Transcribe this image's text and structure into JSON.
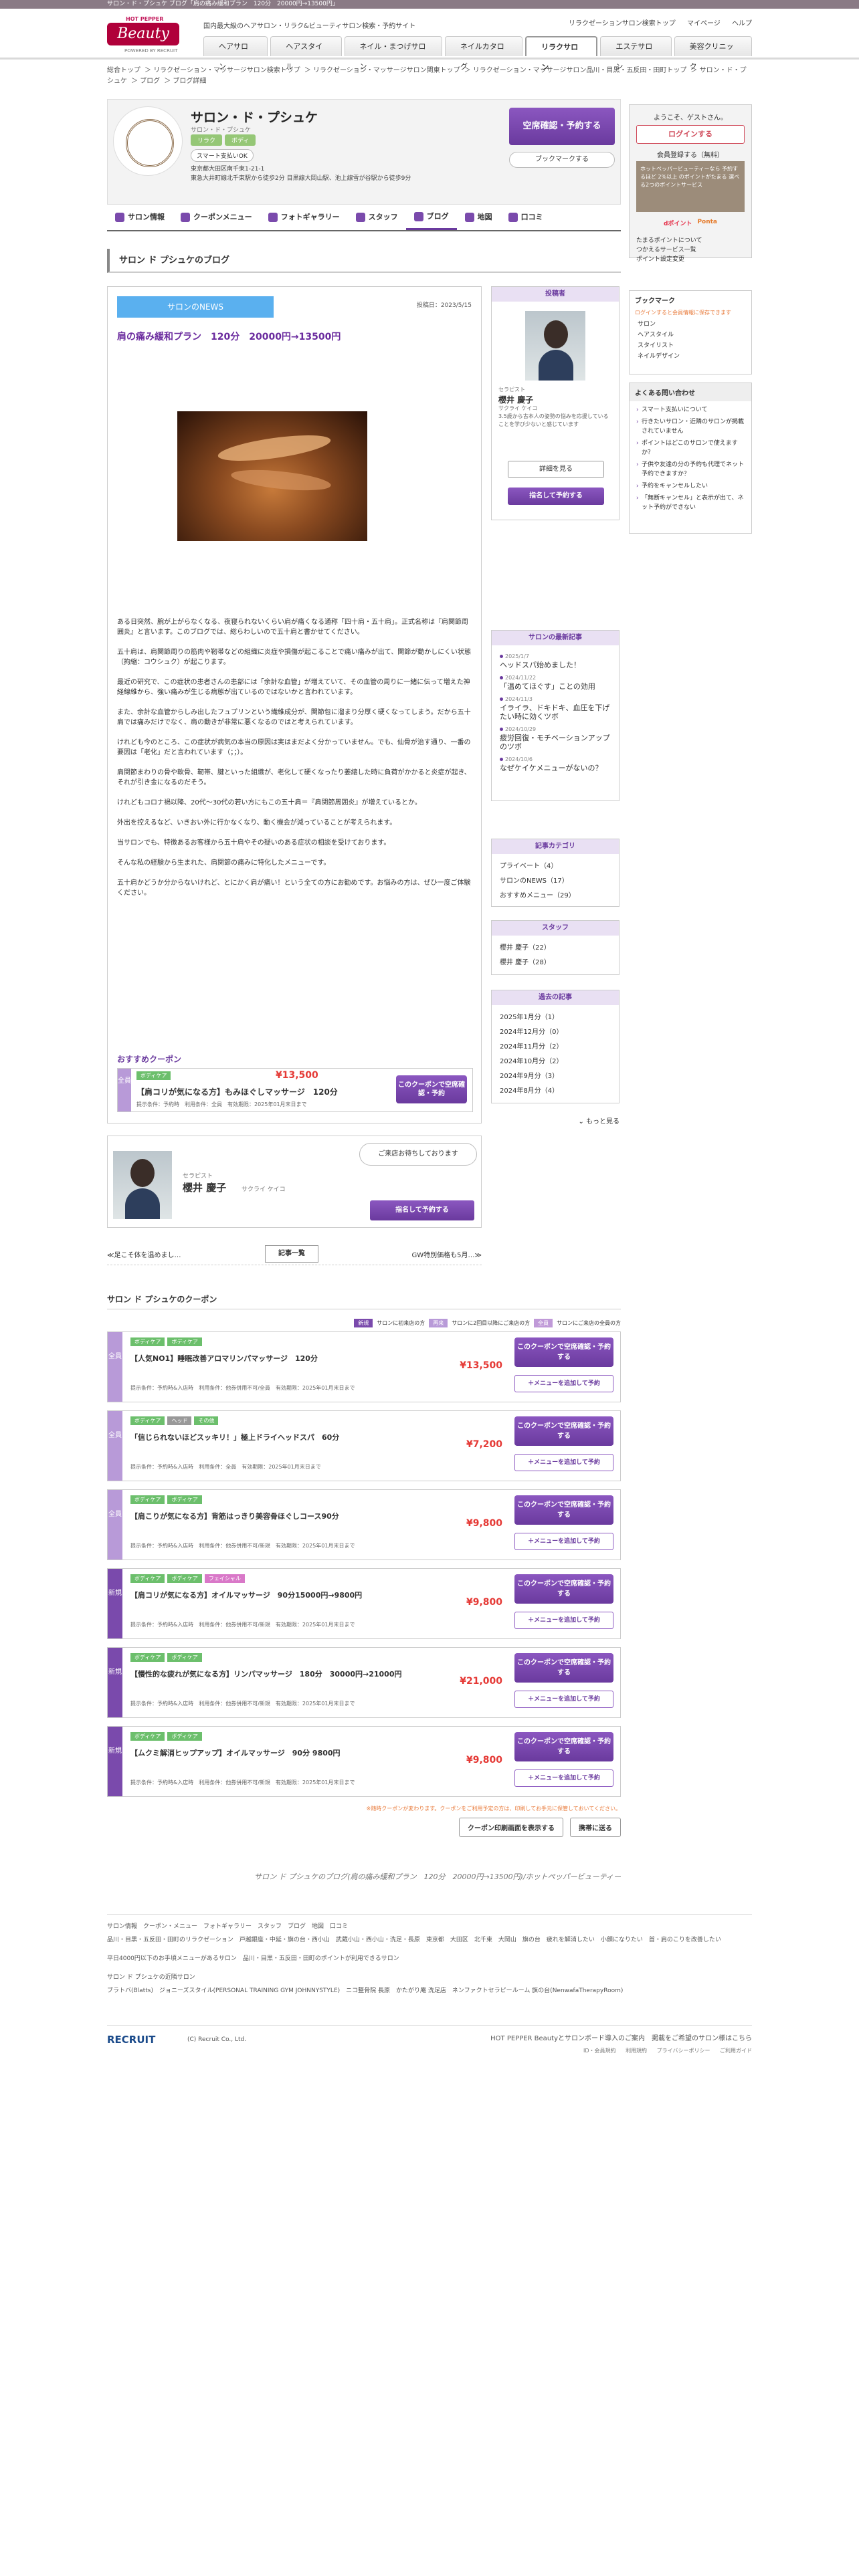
{
  "topbar": "サロン・ド・プシュケ ブログ「肩の痛み緩和プラン　120分　20000円→13500円」",
  "header": {
    "hp_label": "HOT PEPPER",
    "logo": "Beauty",
    "powered": "POWERED BY RECRUIT",
    "tagline": "国内最大級のヘアサロン・リラク&ビューティサロン検索・予約サイト",
    "util": [
      "リラクゼーションサロン検索トップ",
      "マイページ",
      "ヘルプ"
    ],
    "tabs": [
      "ヘアサロン",
      "ヘアスタイル",
      "ネイル・まつげサロン",
      "ネイルカタログ",
      "リラクサロン",
      "エステサロン",
      "美容クリニック"
    ]
  },
  "breadcrumb": [
    "総合トップ",
    "リラクゼーション・マッサージサロン検索トップ",
    "リラクゼーション・マッサージサロン関東トップ",
    "リラクゼーション・マッサージサロン品川・目黒・五反田・田町トップ",
    "サロン・ド・プシュケ",
    "ブログ",
    "ブログ詳細"
  ],
  "salon": {
    "name": "サロン・ド・プシュケ",
    "kana": "サロン・ド・プシュケ",
    "badges": [
      "リラク",
      "ボディ"
    ],
    "smart": "スマート支払いOK",
    "addr1": "東京都大田区南千束1-21-1",
    "addr2": "東急大井町線北千束駅から徒歩2分 目黒線大岡山駅、池上線雪が谷駅から徒歩9分",
    "reserve": "空席確認・予約する",
    "bookmark": "ブックマークする"
  },
  "tabs": [
    "サロン情報",
    "クーポンメニュー",
    "フォトギャラリー",
    "スタッフ",
    "ブログ",
    "地図",
    "口コミ"
  ],
  "page_title": "サロン ド プシュケのブログ",
  "article": {
    "news": "サロンのNEWS",
    "posted": "投稿日：2023/5/15",
    "title": "肩の痛み緩和プラン　120分　20000円→13500円",
    "paras": [
      "ある日突然、腕が上がらなくなる、夜寝られないくらい肩が痛くなる通称「四十肩・五十肩」。正式名称は『肩関節周囲炎』と言います。このブログでは、総らわしいので五十肩と書かせてください。",
      "五十肩は、肩関節周りの筋肉や靭帯などの組織に炎症や損傷が起こることで痛い痛みが出て、関節が動かしにくい状態（拘縮：コウシュク）が起こります。",
      "最近の研究で、この症状の患者さんの患部には「余計な血管」が増えていて、その血管の周りに一緒に伝って増えた神経線維から、強い痛みが生じる病態が出ているのではないかと言われています。",
      "また、余計な血管からしみ出したフュプリンという繊維成分が、関節包に溜まり分厚く硬くなってしまう。だから五十肩では痛みだけでなく、肩の動きが非常に悪くなるのではと考えられています。",
      "けれども今のところ、この症状が病気の本当の原因は実はまだよく分かっていません。でも、仙骨が治す通り、一番の要因は「老化」だと言われています（；；）。",
      "肩関節まわりの骨や軟骨、靭帯、腱といった組織が、老化して硬くなったり萎縮した時に負荷がかかると炎症が起き、それが引き金になるのだそう。",
      "けれどもコロナ禍以降、20代〜30代の若い方にもこの五十肩＝『肩関節周囲炎』が増えているとか。",
      "外出を控えるなど、いきおい外に行かなくなり、動く機会が減っていることが考えられます。",
      "当サロンでも、特徴あるお客様から五十肩やその疑いのある症状の相談を受けております。",
      "そんな私の経験から生まれた、肩関節の痛みに特化したメニューです。",
      "五十肩かどうか分からないけれど、とにかく肩が痛い！という全ての方にお勧めです。お悩みの方は、ぜひ一度ご体験ください。"
    ],
    "coupon_head": "おすすめクーポン",
    "coupon": {
      "side": "全員",
      "tags": [
        "ボディケア"
      ],
      "price": "¥13,500",
      "name": "【肩コリが気になる方】もみほぐしマッサージ　120分",
      "cond": "提示条件：予約時　利用条件：全員　有効期限：2025年01月末日まで",
      "btn": "このクーポンで空席確認・予約"
    }
  },
  "aside": {
    "stylist_head": "投稿者",
    "role": "セラピスト",
    "name": "櫻井 慶子",
    "kana": "サクライ ケイコ",
    "desc": "3.5歳から古本人の姿勢の悩みを応援していることを学び少ないと感じています",
    "detail": "詳細を見る",
    "nominate": "指名して予約する",
    "recent_head": "サロンの最新記事",
    "recent": [
      {
        "d": "2025/1/7",
        "t": "ヘッドスパ始めました！"
      },
      {
        "d": "2024/11/22",
        "t": "「温めてほぐす」ことの効用"
      },
      {
        "d": "2024/11/3",
        "t": "イライラ、ドキドキ、血圧を下げたい時に効くツボ"
      },
      {
        "d": "2024/10/29",
        "t": "疲労回復・モチベーションアップのツボ"
      },
      {
        "d": "2024/10/6",
        "t": "なぜケイケメニューがないの？"
      }
    ],
    "cat_head": "記事カテゴリ",
    "cats": [
      "プライベート（4）",
      "サロンのNEWS（17）",
      "おすすめメニュー（29）"
    ],
    "staff_head": "スタッフ",
    "staff": [
      "櫻井 慶子（22）",
      "櫻井 慶子（28）"
    ],
    "arch_head": "過去の記事",
    "arch": [
      "2025年1月分（1）",
      "2024年12月分（0）",
      "2024年11月分（2）",
      "2024年10月分（2）",
      "2024年9月分（3）",
      "2024年8月分（4）"
    ],
    "more": "もっと見る"
  },
  "stylist2": {
    "bubble": "ご来店お待ちしております",
    "role": "セラピスト",
    "name": "櫻井 慶子",
    "kana": "サクライ ケイコ",
    "btn": "指名して予約する"
  },
  "pager": {
    "prev": "≪足こそ体を温めまし…",
    "list": "記事一覧",
    "next": "GW特別価格も5月…≫"
  },
  "coupons": {
    "head": "サロン ド プシュケのクーポン",
    "legend": [
      {
        "k": "新規",
        "v": "サロンに初来店の方",
        "c": "#7a4aac"
      },
      {
        "k": "再来",
        "v": "サロンに2回目以降にご来店の方",
        "c": "#b89ad8"
      },
      {
        "k": "全員",
        "v": "サロンにご来店の全員の方",
        "c": "#c09ad8"
      }
    ],
    "items": [
      {
        "side": "全員",
        "c": "#b89ad8",
        "tags": [
          "ボディケア",
          "ボディケア"
        ],
        "name": "【人気NO1】睡眠改善アロマリンパマッサージ　120分",
        "price": "¥13,500",
        "cond": "提示条件：予約時&入店時　利用条件：他券併用不可/全員　有効期限：2025年01月末日まで"
      },
      {
        "side": "全員",
        "c": "#b89ad8",
        "tags": [
          "ボディケア",
          "ヘッド",
          "その他"
        ],
        "name": "「信じられないほどスッキリ！」極上ドライヘッドスパ　60分",
        "price": "¥7,200",
        "cond": "提示条件：予約時&入店時　利用条件：全員　有効期限：2025年01月末日まで"
      },
      {
        "side": "全員",
        "c": "#b89ad8",
        "tags": [
          "ボディケア",
          "ボディケア"
        ],
        "name": "【肩こりが気になる方】背筋はっきり美容骨ほぐしコース90分",
        "price": "¥9,800",
        "cond": "提示条件：予約時&入店時　利用条件：他券併用不可/新規　有効期限：2025年01月末日まで"
      },
      {
        "side": "新規",
        "c": "#7a4aac",
        "tags": [
          "ボディケア",
          "ボディケア",
          "フェイシャル"
        ],
        "name": "【肩コリが気になる方】オイルマッサージ　90分15000円→9800円",
        "price": "¥9,800",
        "cond": "提示条件：予約時&入店時　利用条件：他券併用不可/新規　有効期限：2025年01月末日まで"
      },
      {
        "side": "新規",
        "c": "#7a4aac",
        "tags": [
          "ボディケア",
          "ボディケア"
        ],
        "name": "【慢性的な疲れが気になる方】リンパマッサージ　180分　30000円→21000円",
        "price": "¥21,000",
        "cond": "提示条件：予約時&入店時　利用条件：他券併用不可/新規　有効期限：2025年01月末日まで"
      },
      {
        "side": "新規",
        "c": "#7a4aac",
        "tags": [
          "ボディケア",
          "ボディケア"
        ],
        "name": "【ムクミ解消ヒップアップ】オイルマッサージ　90分 9800円",
        "price": "¥9,800",
        "cond": "提示条件：予約時&入店時　利用条件：他券併用不可/新規　有効期限：2025年01月末日まで"
      }
    ],
    "btn1": "このクーポンで空席確認・予約する",
    "btn2": "＋メニューを追加して予約",
    "note": "※随時クーポンが変わります。クーポンをご利用予定の方は、印刷してお手元に保管しておいてください。",
    "print": "クーポン印刷画面を表示する",
    "mobile": "携帯に送る"
  },
  "seo": "サロン ド プシュケのブログ(肩の痛み緩和プラン　120分　20000円→13500円)/ホットペッパービューティー",
  "footlinks": [
    "サロン情報　クーポン・メニュー　フォトギャラリー　スタッフ　ブログ　地図　口コミ",
    "品川・目黒・五反田・田町のリラクゼーション　戸越銀座・中延・旗の台・西小山　武蔵小山・西小山・洗足・長原　東京都　大田区　北千束　大岡山　旗の台　疲れを解消したい　小顔になりたい　首・肩のこりを改善したい",
    "平日4000円以下のお手頃メニューがあるサロン　品川・目黒・五反田・田町のポイントが利用できるサロン",
    "サロン ド プシュケの近隣サロン",
    "ブラトバ(Blatts)　ジョニーズスタイル(PERSONAL TRAINING GYM JOHNNYSTYLE)　ニコ整骨院 長原　かたがり庵 洗足店　ネンファクトセラピールーム 旗の台(NenwafaTherapyRoom)"
  ],
  "footer": {
    "logo": "RECRUIT",
    "copy": "(C) Recruit Co., Ltd.",
    "right": "HOT PEPPER Beautyとサロンボード導入のご案内　掲載をご希望のサロン様はこちら",
    "links": [
      "ID・会員規約",
      "利用規約",
      "プライバシーポリシー",
      "ご利用ガイド"
    ]
  },
  "side": {
    "welcome": "ようこそ、ゲストさん。",
    "login": "ログインする",
    "register": "会員登録する（無料）",
    "point": "ホットペッパービューティーなら 予約するほど 2%以上 のポイントがたまる 選べる2つのポイントサービス",
    "pcards": [
      "Ponta",
      "dポイント"
    ],
    "links": [
      "たまるポイントについて",
      "つかえるサービス一覧",
      "ポイント設定変更"
    ],
    "bkm_head": "ブックマーク",
    "bkm_note": "ログインすると会員情報に保存できます",
    "bkm": [
      "サロン",
      "ヘアスタイル",
      "スタイリスト",
      "ネイルデザイン"
    ],
    "faq_head": "よくある問い合わせ",
    "faq": [
      "スマート支払いについて",
      "行きたいサロン・近隣のサロンが掲載されていません",
      "ポイントはどこのサロンで使えますか？",
      "子供や友達の分の予約も代理でネット予約できますか？",
      "予約をキャンセルしたい",
      "「無断キャンセル」と表示が出て、ネット予約ができない"
    ]
  }
}
